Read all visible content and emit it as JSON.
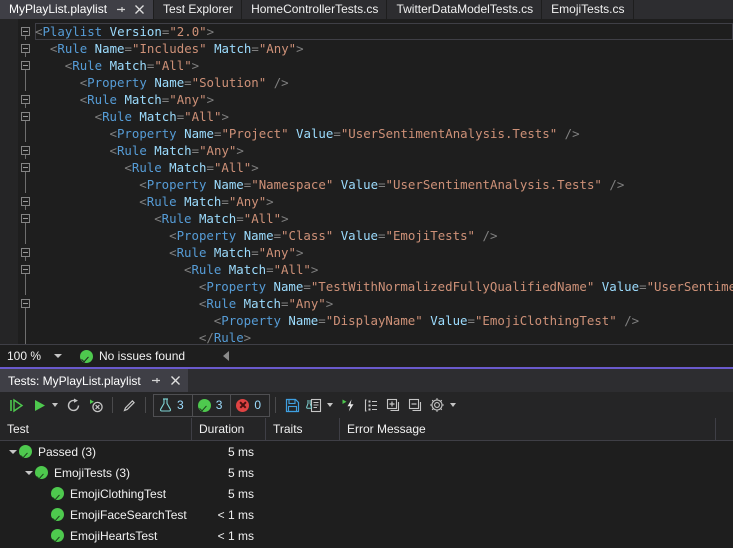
{
  "window": {
    "tabs": [
      {
        "label": "MyPlayList.playlist",
        "active": true,
        "has_pin": true,
        "has_close": true
      },
      {
        "label": "Test Explorer",
        "active": false,
        "has_pin": false,
        "has_close": false
      },
      {
        "label": "HomeControllerTests.cs",
        "active": false,
        "has_pin": false,
        "has_close": false
      },
      {
        "label": "TwitterDataModelTests.cs",
        "active": false,
        "has_pin": false,
        "has_close": false
      },
      {
        "label": "EmojiTests.cs",
        "active": false,
        "has_pin": false,
        "has_close": false
      }
    ]
  },
  "editor": {
    "language": "xml",
    "lines": [
      {
        "indent": 0,
        "outline": "expanded",
        "current": true,
        "tokens": [
          [
            "punct",
            "<"
          ],
          [
            "tag",
            "Playlist"
          ],
          [
            "sp",
            " "
          ],
          [
            "attr",
            "Version"
          ],
          [
            "eq",
            "="
          ],
          [
            "val",
            "\"2.0\""
          ],
          [
            "punct",
            ">"
          ]
        ]
      },
      {
        "indent": 2,
        "outline": "expanded",
        "tokens": [
          [
            "punct",
            "<"
          ],
          [
            "tag",
            "Rule"
          ],
          [
            "sp",
            " "
          ],
          [
            "attr",
            "Name"
          ],
          [
            "eq",
            "="
          ],
          [
            "val",
            "\"Includes\""
          ],
          [
            "sp",
            " "
          ],
          [
            "attr",
            "Match"
          ],
          [
            "eq",
            "="
          ],
          [
            "val",
            "\"Any\""
          ],
          [
            "punct",
            ">"
          ]
        ]
      },
      {
        "indent": 4,
        "outline": "expanded",
        "tokens": [
          [
            "punct",
            "<"
          ],
          [
            "tag",
            "Rule"
          ],
          [
            "sp",
            " "
          ],
          [
            "attr",
            "Match"
          ],
          [
            "eq",
            "="
          ],
          [
            "val",
            "\"All\""
          ],
          [
            "punct",
            ">"
          ]
        ]
      },
      {
        "indent": 6,
        "outline": "line",
        "tokens": [
          [
            "punct",
            "<"
          ],
          [
            "tag",
            "Property"
          ],
          [
            "sp",
            " "
          ],
          [
            "attr",
            "Name"
          ],
          [
            "eq",
            "="
          ],
          [
            "val",
            "\"Solution\""
          ],
          [
            "sp",
            " "
          ],
          [
            "slash",
            "/>"
          ]
        ]
      },
      {
        "indent": 6,
        "outline": "expanded",
        "tokens": [
          [
            "punct",
            "<"
          ],
          [
            "tag",
            "Rule"
          ],
          [
            "sp",
            " "
          ],
          [
            "attr",
            "Match"
          ],
          [
            "eq",
            "="
          ],
          [
            "val",
            "\"Any\""
          ],
          [
            "punct",
            ">"
          ]
        ]
      },
      {
        "indent": 8,
        "outline": "expanded",
        "tokens": [
          [
            "punct",
            "<"
          ],
          [
            "tag",
            "Rule"
          ],
          [
            "sp",
            " "
          ],
          [
            "attr",
            "Match"
          ],
          [
            "eq",
            "="
          ],
          [
            "val",
            "\"All\""
          ],
          [
            "punct",
            ">"
          ]
        ]
      },
      {
        "indent": 10,
        "outline": "line",
        "tokens": [
          [
            "punct",
            "<"
          ],
          [
            "tag",
            "Property"
          ],
          [
            "sp",
            " "
          ],
          [
            "attr",
            "Name"
          ],
          [
            "eq",
            "="
          ],
          [
            "val",
            "\"Project\""
          ],
          [
            "sp",
            " "
          ],
          [
            "attr",
            "Value"
          ],
          [
            "eq",
            "="
          ],
          [
            "val",
            "\"UserSentimentAnalysis.Tests\""
          ],
          [
            "sp",
            " "
          ],
          [
            "slash",
            "/>"
          ]
        ]
      },
      {
        "indent": 10,
        "outline": "expanded",
        "tokens": [
          [
            "punct",
            "<"
          ],
          [
            "tag",
            "Rule"
          ],
          [
            "sp",
            " "
          ],
          [
            "attr",
            "Match"
          ],
          [
            "eq",
            "="
          ],
          [
            "val",
            "\"Any\""
          ],
          [
            "punct",
            ">"
          ]
        ]
      },
      {
        "indent": 12,
        "outline": "expanded",
        "tokens": [
          [
            "punct",
            "<"
          ],
          [
            "tag",
            "Rule"
          ],
          [
            "sp",
            " "
          ],
          [
            "attr",
            "Match"
          ],
          [
            "eq",
            "="
          ],
          [
            "val",
            "\"All\""
          ],
          [
            "punct",
            ">"
          ]
        ]
      },
      {
        "indent": 14,
        "outline": "line",
        "tokens": [
          [
            "punct",
            "<"
          ],
          [
            "tag",
            "Property"
          ],
          [
            "sp",
            " "
          ],
          [
            "attr",
            "Name"
          ],
          [
            "eq",
            "="
          ],
          [
            "val",
            "\"Namespace\""
          ],
          [
            "sp",
            " "
          ],
          [
            "attr",
            "Value"
          ],
          [
            "eq",
            "="
          ],
          [
            "val",
            "\"UserSentimentAnalysis.Tests\""
          ],
          [
            "sp",
            " "
          ],
          [
            "slash",
            "/>"
          ]
        ]
      },
      {
        "indent": 14,
        "outline": "expanded",
        "tokens": [
          [
            "punct",
            "<"
          ],
          [
            "tag",
            "Rule"
          ],
          [
            "sp",
            " "
          ],
          [
            "attr",
            "Match"
          ],
          [
            "eq",
            "="
          ],
          [
            "val",
            "\"Any\""
          ],
          [
            "punct",
            ">"
          ]
        ]
      },
      {
        "indent": 16,
        "outline": "expanded",
        "tokens": [
          [
            "punct",
            "<"
          ],
          [
            "tag",
            "Rule"
          ],
          [
            "sp",
            " "
          ],
          [
            "attr",
            "Match"
          ],
          [
            "eq",
            "="
          ],
          [
            "val",
            "\"All\""
          ],
          [
            "punct",
            ">"
          ]
        ]
      },
      {
        "indent": 18,
        "outline": "line",
        "tokens": [
          [
            "punct",
            "<"
          ],
          [
            "tag",
            "Property"
          ],
          [
            "sp",
            " "
          ],
          [
            "attr",
            "Name"
          ],
          [
            "eq",
            "="
          ],
          [
            "val",
            "\"Class\""
          ],
          [
            "sp",
            " "
          ],
          [
            "attr",
            "Value"
          ],
          [
            "eq",
            "="
          ],
          [
            "val",
            "\"EmojiTests\""
          ],
          [
            "sp",
            " "
          ],
          [
            "slash",
            "/>"
          ]
        ]
      },
      {
        "indent": 18,
        "outline": "expanded",
        "tokens": [
          [
            "punct",
            "<"
          ],
          [
            "tag",
            "Rule"
          ],
          [
            "sp",
            " "
          ],
          [
            "attr",
            "Match"
          ],
          [
            "eq",
            "="
          ],
          [
            "val",
            "\"Any\""
          ],
          [
            "punct",
            ">"
          ]
        ]
      },
      {
        "indent": 20,
        "outline": "expanded",
        "tokens": [
          [
            "punct",
            "<"
          ],
          [
            "tag",
            "Rule"
          ],
          [
            "sp",
            " "
          ],
          [
            "attr",
            "Match"
          ],
          [
            "eq",
            "="
          ],
          [
            "val",
            "\"All\""
          ],
          [
            "punct",
            ">"
          ]
        ]
      },
      {
        "indent": 22,
        "outline": "line",
        "tokens": [
          [
            "punct",
            "<"
          ],
          [
            "tag",
            "Property"
          ],
          [
            "sp",
            " "
          ],
          [
            "attr",
            "Name"
          ],
          [
            "eq",
            "="
          ],
          [
            "val",
            "\"TestWithNormalizedFullyQualifiedName\""
          ],
          [
            "sp",
            " "
          ],
          [
            "attr",
            "Value"
          ],
          [
            "eq",
            "="
          ],
          [
            "val",
            "\"UserSentimentA"
          ]
        ]
      },
      {
        "indent": 22,
        "outline": "expanded",
        "tokens": [
          [
            "punct",
            "<"
          ],
          [
            "tag",
            "Rule"
          ],
          [
            "sp",
            " "
          ],
          [
            "attr",
            "Match"
          ],
          [
            "eq",
            "="
          ],
          [
            "val",
            "\"Any\""
          ],
          [
            "punct",
            ">"
          ]
        ]
      },
      {
        "indent": 24,
        "outline": "line",
        "tokens": [
          [
            "punct",
            "<"
          ],
          [
            "tag",
            "Property"
          ],
          [
            "sp",
            " "
          ],
          [
            "attr",
            "Name"
          ],
          [
            "eq",
            "="
          ],
          [
            "val",
            "\"DisplayName\""
          ],
          [
            "sp",
            " "
          ],
          [
            "attr",
            "Value"
          ],
          [
            "eq",
            "="
          ],
          [
            "val",
            "\"EmojiClothingTest\""
          ],
          [
            "sp",
            " "
          ],
          [
            "slash",
            "/>"
          ]
        ]
      },
      {
        "indent": 22,
        "outline": "none",
        "tokens": [
          [
            "punct",
            "</"
          ],
          [
            "tag",
            "Rule"
          ],
          [
            "punct",
            ">"
          ]
        ]
      }
    ]
  },
  "editor_status": {
    "zoom_level": "100 %",
    "issues_text": "No issues found",
    "issues_icon": "check-circle-icon",
    "zoom_caret_icon": "chevron-down-icon",
    "nav_caret_icon": "triangle-left-icon"
  },
  "test_panel": {
    "title": "Tests: MyPlayList.playlist",
    "pin_icon": "pin-icon",
    "close_icon": "close-icon",
    "toolbar": {
      "buttons": [
        {
          "name": "run-all-tests-button",
          "icon": "run-all-icon"
        },
        {
          "name": "run-button",
          "icon": "play-icon"
        },
        {
          "name": "run-dropdown-button",
          "icon": "chevron-down-icon"
        },
        {
          "name": "repeat-last-run-button",
          "icon": "repeat-icon"
        },
        {
          "name": "cancel-button",
          "icon": "stop-cancel-icon"
        },
        {
          "name": "separator-1",
          "icon": "divider"
        },
        {
          "name": "edit-playlist-button",
          "icon": "pencil-icon"
        },
        {
          "name": "separator-2",
          "icon": "divider"
        }
      ],
      "counters": [
        {
          "name": "total-tests-counter",
          "icon": "flask-icon",
          "value": "3",
          "value_color": "#9cdcfe"
        },
        {
          "name": "passed-tests-counter",
          "icon": "pass-icon",
          "value": "3",
          "value_color": "#9cdcfe"
        },
        {
          "name": "failed-tests-counter",
          "icon": "fail-icon",
          "value": "0",
          "value_color": "#9cdcfe"
        }
      ],
      "buttons_right": [
        {
          "name": "separator-3",
          "icon": "divider"
        },
        {
          "name": "save-playlist-button",
          "icon": "save-icon"
        },
        {
          "name": "create-playlist-button",
          "icon": "playlist-icon"
        },
        {
          "name": "playlist-dropdown-button",
          "icon": "chevron-down-icon"
        },
        {
          "name": "run-settings-button",
          "icon": "run-lightning-icon"
        },
        {
          "name": "group-by-button",
          "icon": "list-icon"
        },
        {
          "name": "expand-all-button",
          "icon": "expand-plus-icon"
        },
        {
          "name": "collapse-all-button",
          "icon": "collapse-minus-icon"
        },
        {
          "name": "settings-button",
          "icon": "gear-icon"
        },
        {
          "name": "settings-dropdown-button",
          "icon": "chevron-down-icon"
        }
      ]
    },
    "grid": {
      "columns": [
        {
          "key": "test",
          "label": "Test"
        },
        {
          "key": "duration",
          "label": "Duration"
        },
        {
          "key": "traits",
          "label": "Traits"
        },
        {
          "key": "error",
          "label": "Error Message"
        }
      ],
      "rows": [
        {
          "level": 0,
          "expander": "expanded",
          "status": "passed",
          "label": "Passed (3)",
          "duration": "5 ms",
          "traits": "",
          "error": ""
        },
        {
          "level": 1,
          "expander": "expanded",
          "status": "passed",
          "label": "EmojiTests (3)",
          "duration": "5 ms",
          "traits": "",
          "error": ""
        },
        {
          "level": 2,
          "expander": "none",
          "status": "passed",
          "label": "EmojiClothingTest",
          "duration": "5 ms",
          "traits": "",
          "error": ""
        },
        {
          "level": 2,
          "expander": "none",
          "status": "passed",
          "label": "EmojiFaceSearchTest",
          "duration": "< 1 ms",
          "traits": "",
          "error": ""
        },
        {
          "level": 2,
          "expander": "none",
          "status": "passed",
          "label": "EmojiHeartsTest",
          "duration": "< 1 ms",
          "traits": "",
          "error": ""
        }
      ]
    }
  },
  "colors": {
    "background": "#1e1e1e",
    "chrome": "#2d2d30",
    "active_tab": "#3f3f46",
    "accent_purple": "#6a5acd",
    "pass_green": "#4ec94e",
    "fail_red": "#e04343",
    "xml_tag": "#569cd6",
    "xml_attr": "#9cdcfe",
    "xml_value": "#ce9178",
    "xml_punct": "#808080"
  }
}
